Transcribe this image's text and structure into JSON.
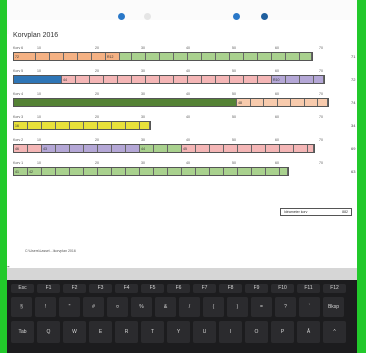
{
  "document": {
    "title": "Korvplan 2016",
    "path": "C:\\Users\\Lasse\\...\\korvplan 2016",
    "summary": {
      "label": "Idéameter korv",
      "value": "882"
    }
  },
  "rows": [
    {
      "label": "Korv 6",
      "total": "71",
      "segments": [
        {
          "w": 22,
          "color": "#f4b183",
          "text": "72"
        },
        {
          "w": 14,
          "color": "#f4b183",
          "text": ""
        },
        {
          "w": 14,
          "color": "#f4b183",
          "text": ""
        },
        {
          "w": 14,
          "color": "#f4b183",
          "text": ""
        },
        {
          "w": 14,
          "color": "#f4b183",
          "text": ""
        },
        {
          "w": 14,
          "color": "#f4b183",
          "text": ""
        },
        {
          "w": 14,
          "color": "#f4b183",
          "text": "R12"
        },
        {
          "w": 12,
          "color": "#a9d18e",
          "text": ""
        },
        {
          "w": 14,
          "color": "#a9d18e",
          "text": ""
        },
        {
          "w": 14,
          "color": "#a9d18e",
          "text": ""
        },
        {
          "w": 14,
          "color": "#a9d18e",
          "text": ""
        },
        {
          "w": 14,
          "color": "#a9d18e",
          "text": ""
        },
        {
          "w": 14,
          "color": "#a9d18e",
          "text": ""
        },
        {
          "w": 14,
          "color": "#a9d18e",
          "text": ""
        },
        {
          "w": 14,
          "color": "#a9d18e",
          "text": ""
        },
        {
          "w": 14,
          "color": "#a9d18e",
          "text": ""
        },
        {
          "w": 14,
          "color": "#a9d18e",
          "text": ""
        },
        {
          "w": 14,
          "color": "#a9d18e",
          "text": ""
        },
        {
          "w": 14,
          "color": "#a9d18e",
          "text": ""
        },
        {
          "w": 14,
          "color": "#a9d18e",
          "text": ""
        },
        {
          "w": 12,
          "color": "#a9d18e",
          "text": ""
        }
      ]
    },
    {
      "label": "Korv 5",
      "total": "72",
      "segments": [
        {
          "w": 48,
          "color": "#2e75b6",
          "text": ""
        },
        {
          "w": 14,
          "color": "#f4b6b6",
          "text": "44"
        },
        {
          "w": 14,
          "color": "#f4b6b6",
          "text": ""
        },
        {
          "w": 14,
          "color": "#f4b6b6",
          "text": ""
        },
        {
          "w": 14,
          "color": "#f4b6b6",
          "text": ""
        },
        {
          "w": 14,
          "color": "#f4b6b6",
          "text": ""
        },
        {
          "w": 14,
          "color": "#f4b6b6",
          "text": ""
        },
        {
          "w": 14,
          "color": "#f4b6b6",
          "text": ""
        },
        {
          "w": 14,
          "color": "#f4b6b6",
          "text": ""
        },
        {
          "w": 14,
          "color": "#f4b6b6",
          "text": ""
        },
        {
          "w": 14,
          "color": "#f4b6b6",
          "text": ""
        },
        {
          "w": 14,
          "color": "#f4b6b6",
          "text": ""
        },
        {
          "w": 14,
          "color": "#f4b6b6",
          "text": ""
        },
        {
          "w": 14,
          "color": "#f4b6b6",
          "text": ""
        },
        {
          "w": 14,
          "color": "#f4b6b6",
          "text": ""
        },
        {
          "w": 14,
          "color": "#f4b6b6",
          "text": ""
        },
        {
          "w": 14,
          "color": "#b4a7d6",
          "text": "R10"
        },
        {
          "w": 14,
          "color": "#b4a7d6",
          "text": ""
        },
        {
          "w": 14,
          "color": "#b4a7d6",
          "text": ""
        },
        {
          "w": 10,
          "color": "#b4a7d6",
          "text": ""
        }
      ]
    },
    {
      "label": "Korv 4",
      "total": "74",
      "segments": [
        {
          "w": 232,
          "color": "#548235",
          "text": ""
        },
        {
          "w": 14,
          "color": "#f8cbad",
          "text": "48"
        },
        {
          "w": 14,
          "color": "#f8cbad",
          "text": ""
        },
        {
          "w": 14,
          "color": "#f8cbad",
          "text": ""
        },
        {
          "w": 14,
          "color": "#f8cbad",
          "text": ""
        },
        {
          "w": 14,
          "color": "#f8cbad",
          "text": ""
        },
        {
          "w": 14,
          "color": "#f8cbad",
          "text": ""
        },
        {
          "w": 10,
          "color": "#f8cbad",
          "text": ""
        }
      ]
    },
    {
      "label": "Korv 3",
      "total": "34",
      "segments": [
        {
          "w": 14,
          "color": "#e8e03a",
          "text": "16"
        },
        {
          "w": 14,
          "color": "#e8e03a",
          "text": ""
        },
        {
          "w": 14,
          "color": "#e8e03a",
          "text": ""
        },
        {
          "w": 14,
          "color": "#e8e03a",
          "text": ""
        },
        {
          "w": 14,
          "color": "#e8e03a",
          "text": ""
        },
        {
          "w": 14,
          "color": "#e8e03a",
          "text": ""
        },
        {
          "w": 14,
          "color": "#e8e03a",
          "text": ""
        },
        {
          "w": 14,
          "color": "#e8e03a",
          "text": ""
        },
        {
          "w": 14,
          "color": "#e8e03a",
          "text": ""
        },
        {
          "w": 10,
          "color": "#e8e03a",
          "text": ""
        }
      ]
    },
    {
      "label": "Korv 2",
      "total": "69",
      "segments": [
        {
          "w": 14,
          "color": "#f4b6b6",
          "text": "46"
        },
        {
          "w": 14,
          "color": "#f4b6b6",
          "text": ""
        },
        {
          "w": 14,
          "color": "#b4a7d6",
          "text": "43"
        },
        {
          "w": 14,
          "color": "#b4a7d6",
          "text": ""
        },
        {
          "w": 14,
          "color": "#b4a7d6",
          "text": ""
        },
        {
          "w": 14,
          "color": "#b4a7d6",
          "text": ""
        },
        {
          "w": 14,
          "color": "#b4a7d6",
          "text": ""
        },
        {
          "w": 14,
          "color": "#b4a7d6",
          "text": ""
        },
        {
          "w": 14,
          "color": "#b4a7d6",
          "text": ""
        },
        {
          "w": 14,
          "color": "#a9d18e",
          "text": "44"
        },
        {
          "w": 14,
          "color": "#a9d18e",
          "text": ""
        },
        {
          "w": 14,
          "color": "#a9d18e",
          "text": ""
        },
        {
          "w": 14,
          "color": "#f4b6b6",
          "text": "45"
        },
        {
          "w": 14,
          "color": "#f4b6b6",
          "text": ""
        },
        {
          "w": 14,
          "color": "#f4b6b6",
          "text": ""
        },
        {
          "w": 14,
          "color": "#f4b6b6",
          "text": ""
        },
        {
          "w": 14,
          "color": "#f4b6b6",
          "text": ""
        },
        {
          "w": 14,
          "color": "#f4b6b6",
          "text": ""
        },
        {
          "w": 14,
          "color": "#f4b6b6",
          "text": ""
        },
        {
          "w": 14,
          "color": "#f4b6b6",
          "text": ""
        },
        {
          "w": 14,
          "color": "#f4b6b6",
          "text": ""
        },
        {
          "w": 6,
          "color": "#f4b6b6",
          "text": ""
        }
      ]
    },
    {
      "label": "Korv 1",
      "total": "63",
      "segments": [
        {
          "w": 14,
          "color": "#a9d18e",
          "text": "41"
        },
        {
          "w": 14,
          "color": "#a9d18e",
          "text": "42"
        },
        {
          "w": 14,
          "color": "#a9d18e",
          "text": ""
        },
        {
          "w": 14,
          "color": "#a9d18e",
          "text": ""
        },
        {
          "w": 14,
          "color": "#a9d18e",
          "text": ""
        },
        {
          "w": 14,
          "color": "#a9d18e",
          "text": ""
        },
        {
          "w": 14,
          "color": "#a9d18e",
          "text": ""
        },
        {
          "w": 14,
          "color": "#a9d18e",
          "text": ""
        },
        {
          "w": 14,
          "color": "#a9d18e",
          "text": ""
        },
        {
          "w": 14,
          "color": "#a9d18e",
          "text": ""
        },
        {
          "w": 14,
          "color": "#a9d18e",
          "text": ""
        },
        {
          "w": 14,
          "color": "#a9d18e",
          "text": ""
        },
        {
          "w": 14,
          "color": "#a9d18e",
          "text": ""
        },
        {
          "w": 14,
          "color": "#a9d18e",
          "text": ""
        },
        {
          "w": 14,
          "color": "#a9d18e",
          "text": ""
        },
        {
          "w": 14,
          "color": "#a9d18e",
          "text": ""
        },
        {
          "w": 14,
          "color": "#a9d18e",
          "text": ""
        },
        {
          "w": 14,
          "color": "#a9d18e",
          "text": ""
        },
        {
          "w": 14,
          "color": "#a9d18e",
          "text": ""
        },
        {
          "w": 8,
          "color": "#a9d18e",
          "text": ""
        }
      ]
    }
  ],
  "ticks": [
    "10",
    "20",
    "30",
    "40",
    "50",
    "60",
    "70"
  ],
  "keyboard": {
    "row1": [
      "Esc",
      "F1",
      "F2",
      "F3",
      "F4",
      "F5",
      "F6",
      "F7",
      "F8",
      "F9",
      "F10",
      "F11",
      "F12"
    ],
    "row2": [
      "§",
      "!",
      "\"",
      "#",
      "¤",
      "%",
      "&",
      "/",
      "(",
      ")",
      "=",
      "?",
      "`",
      "Bksp"
    ],
    "row3": [
      "Tab",
      "Q",
      "W",
      "E",
      "R",
      "T",
      "Y",
      "U",
      "I",
      "O",
      "P",
      "Å",
      "^"
    ]
  },
  "colors": {
    "frame": "#22c92b",
    "keyboard": "#1c1c1e"
  }
}
